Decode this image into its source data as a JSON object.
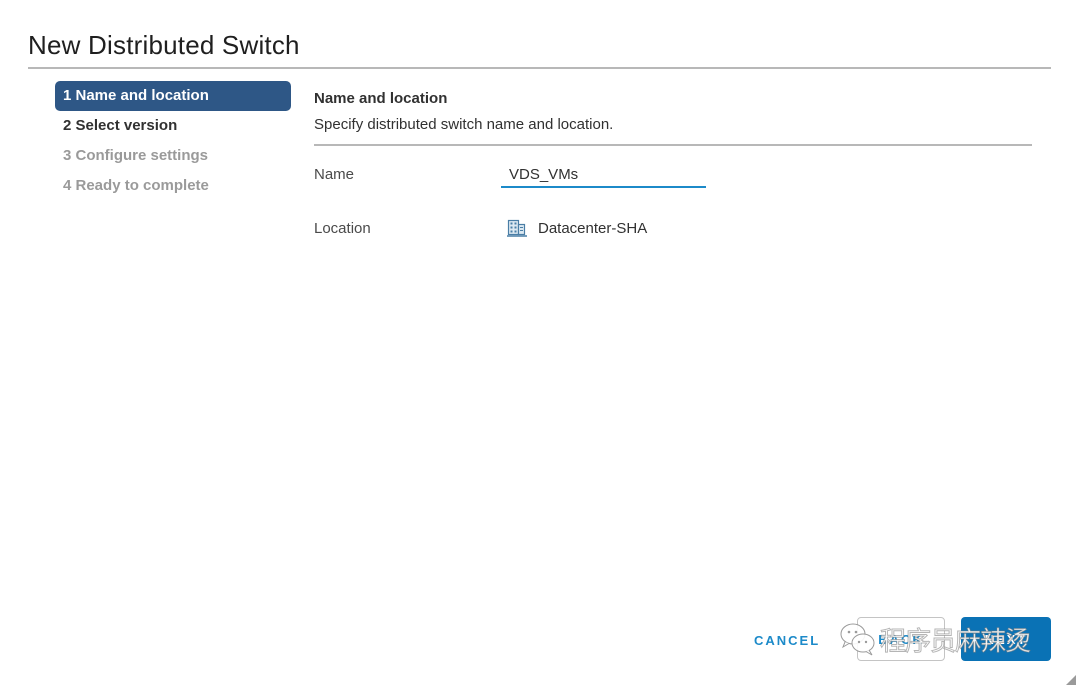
{
  "dialog": {
    "title": "New Distributed Switch"
  },
  "steps": [
    {
      "label": "1 Name and location",
      "state": "active"
    },
    {
      "label": "2 Select version",
      "state": "enabled"
    },
    {
      "label": "3 Configure settings",
      "state": "disabled"
    },
    {
      "label": "4 Ready to complete",
      "state": "disabled"
    }
  ],
  "content": {
    "section_title": "Name and location",
    "section_description": "Specify distributed switch name and location.",
    "name_label": "Name",
    "name_value": "VDS_VMs",
    "location_label": "Location",
    "location_icon": "datacenter-icon",
    "location_value": "Datacenter-SHA"
  },
  "footer": {
    "cancel_label": "CANCEL",
    "back_label": "BACK",
    "next_label": "NEXT"
  },
  "watermark": {
    "icon": "wechat-icon",
    "text": "程序员麻辣烫"
  },
  "colors": {
    "active_step_bg": "#2e5786",
    "accent_blue": "#1c8ac9",
    "primary_button": "#0a72b5",
    "disabled_text": "#9a9a9a"
  }
}
